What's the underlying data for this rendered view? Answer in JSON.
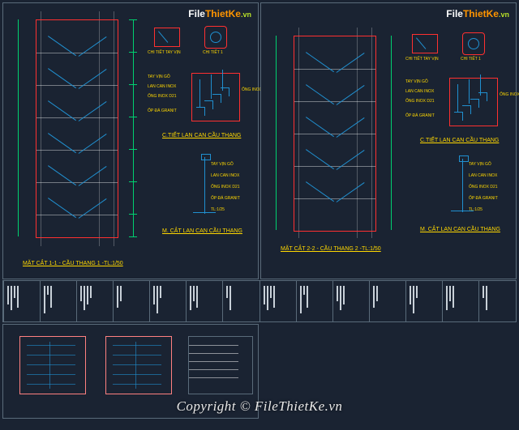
{
  "watermark": {
    "file": "File",
    "thiet": "ThietKe",
    "vn": ".vn"
  },
  "copyright": "Copyright © FileThietKe.vn",
  "left_panel": {
    "section_title": "MẶT CẮT 1-1 - CẦU THANG 1 -TL:1/50",
    "detail1_title": "C.TIẾT LAN CAN CẦU THANG",
    "detail2_title": "M. CẮT LAN CAN CẦU THANG",
    "ann1": "CHI TIẾT TAY VỊN",
    "ann2": "CHI TIẾT 1",
    "note1": "TAY VỊN GỖ",
    "note2": "LAN CAN INOX",
    "note3": "ỐNG INOX D21",
    "note4": "ỐP ĐÁ GRANIT",
    "note5": "TL:1/25"
  },
  "right_panel": {
    "section_title": "MẶT CẮT 2-2 - CẦU THANG 2 -TL:1/50",
    "detail1_title": "C.TIẾT LAN CAN CẦU THANG",
    "detail2_title": "M. CẮT LAN CAN CẦU THANG",
    "ann1": "CHI TIẾT TAY VỊN",
    "ann2": "CHI TIẾT 1",
    "note1": "TAY VỊN GỖ",
    "note2": "LAN CAN INOX",
    "note3": "ỐNG INOX D21",
    "note4": "ỐP ĐÁ GRANIT",
    "note5": "TL:1/25"
  },
  "title_block": {
    "cells": 14
  }
}
